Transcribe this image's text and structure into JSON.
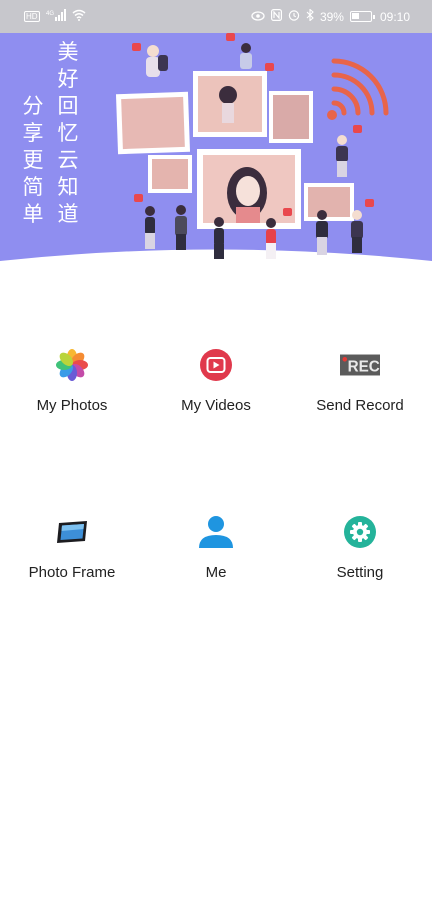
{
  "status_bar": {
    "network_badge": "HD",
    "signal": "4G",
    "battery_percent": "39%",
    "battery_level": 0.39,
    "time": "09:10"
  },
  "banner": {
    "slogan_lines": [
      "美好回忆云知道",
      "分享更简单"
    ]
  },
  "menu": {
    "items": [
      {
        "label": "My Photos",
        "icon": "photos-flower-icon"
      },
      {
        "label": "My Videos",
        "icon": "play-circle-icon"
      },
      {
        "label": "Send Record",
        "icon": "rec-icon",
        "icon_text": "REC"
      },
      {
        "label": "Photo Frame",
        "icon": "photo-frame-icon"
      },
      {
        "label": "Me",
        "icon": "person-icon"
      },
      {
        "label": "Setting",
        "icon": "gear-icon"
      }
    ]
  },
  "colors": {
    "banner_bg": "#8f8ef0",
    "status_bar_bg": "#c7c7cc",
    "videos_red": "#e0394c",
    "me_blue": "#1f95e0",
    "setting_teal": "#24b39a"
  }
}
